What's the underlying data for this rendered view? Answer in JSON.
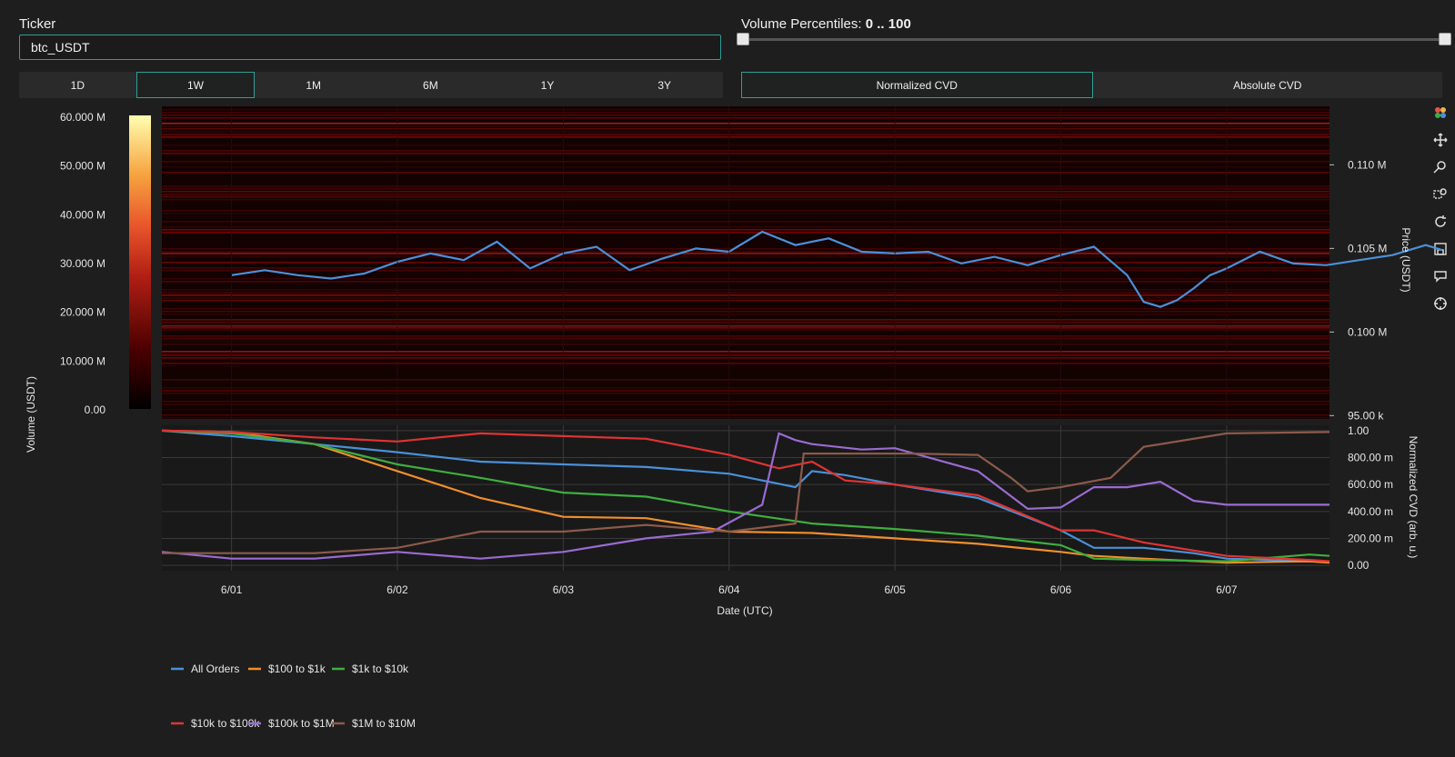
{
  "ticker": {
    "label": "Ticker",
    "value": "btc_USDT"
  },
  "volume_percentiles": {
    "label": "Volume Percentiles:",
    "value": "0 .. 100",
    "min": 0,
    "max": 100
  },
  "timeframes": [
    {
      "label": "1D",
      "active": false
    },
    {
      "label": "1W",
      "active": true
    },
    {
      "label": "1M",
      "active": false
    },
    {
      "label": "6M",
      "active": false
    },
    {
      "label": "1Y",
      "active": false
    },
    {
      "label": "3Y",
      "active": false
    }
  ],
  "cvd_modes": [
    {
      "label": "Normalized CVD",
      "active": true
    },
    {
      "label": "Absolute CVD",
      "active": false
    }
  ],
  "toolbar": [
    {
      "icon": "plotly-logo-icon"
    },
    {
      "icon": "pan-icon"
    },
    {
      "icon": "zoom-icon"
    },
    {
      "icon": "box-select-icon"
    },
    {
      "icon": "reset-icon"
    },
    {
      "icon": "save-icon"
    },
    {
      "icon": "hover-icon"
    },
    {
      "icon": "crosshair-icon"
    }
  ],
  "colors": {
    "accent": "#2f9e95",
    "price": "#4a90d9"
  },
  "chart_data": [
    {
      "type": "heatmap",
      "colorbar": {
        "title": "Volume (USDT)",
        "ticks": [
          "60.000 M",
          "50.000 M",
          "40.000 M",
          "30.000 M",
          "20.000 M",
          "10.000 M",
          "0.00"
        ],
        "range": [
          0,
          60
        ]
      },
      "y2label": "Price (USDT)",
      "y2ticks": [
        {
          "label": "0.110 M",
          "value": 110000
        },
        {
          "label": "0.105 M",
          "value": 105000
        },
        {
          "label": "0.100 M",
          "value": 100000
        },
        {
          "label": "95.00 k",
          "value": 95000
        }
      ],
      "ylim": [
        94800,
        113500
      ],
      "price_series": {
        "name": "price",
        "x": [
          0.0,
          0.2,
          0.4,
          0.6,
          0.8,
          1.0,
          1.2,
          1.4,
          1.6,
          1.8,
          2.0,
          2.2,
          2.4,
          2.6,
          2.8,
          3.0,
          3.2,
          3.4,
          3.6,
          3.8,
          4.0,
          4.2,
          4.4,
          4.6,
          4.8,
          5.0,
          5.2,
          5.4,
          5.5,
          5.6,
          5.7,
          5.8,
          5.9,
          6.0,
          6.2,
          6.4,
          6.6,
          6.8,
          7.0,
          7.2,
          7.3
        ],
        "y": [
          103400,
          103700,
          103400,
          103200,
          103500,
          104200,
          104700,
          104300,
          105400,
          103800,
          104700,
          105100,
          103700,
          104400,
          105000,
          104800,
          106000,
          105200,
          105600,
          104800,
          104700,
          104800,
          104100,
          104500,
          104000,
          104600,
          105100,
          103400,
          101800,
          101500,
          101900,
          102600,
          103400,
          103800,
          104800,
          104100,
          104000,
          104300,
          104600,
          105200,
          104900
        ]
      }
    },
    {
      "type": "line",
      "xlabel": "Date (UTC)",
      "ylabel": "Normalized CVD (arb. u.)",
      "categories": [
        "6/01",
        "6/02",
        "6/03",
        "6/04",
        "6/05",
        "6/06",
        "6/07"
      ],
      "yticks": [
        "1.00",
        "800.00 m",
        "600.00 m",
        "400.00 m",
        "200.00 m",
        "0.00"
      ],
      "xlim": [
        -0.42,
        6.62
      ],
      "ylim": [
        -0.04,
        1.04
      ],
      "series": [
        {
          "name": "All Orders",
          "color": "#4a90d9",
          "x": [
            -0.42,
            0.0,
            0.5,
            1.0,
            1.5,
            2.0,
            2.5,
            3.0,
            3.4,
            3.5,
            3.7,
            4.0,
            4.5,
            5.0,
            5.2,
            5.5,
            5.8,
            6.0,
            6.5,
            6.62
          ],
          "y": [
            1.0,
            0.96,
            0.9,
            0.84,
            0.77,
            0.75,
            0.73,
            0.68,
            0.58,
            0.7,
            0.67,
            0.6,
            0.5,
            0.26,
            0.13,
            0.13,
            0.09,
            0.05,
            0.03,
            0.03
          ]
        },
        {
          "name": "$100 to $1k",
          "color": "#f08f2a",
          "x": [
            -0.42,
            0.0,
            0.5,
            1.0,
            1.5,
            2.0,
            2.5,
            3.0,
            3.5,
            4.0,
            4.5,
            5.0,
            5.2,
            5.5,
            6.0,
            6.5,
            6.62
          ],
          "y": [
            1.0,
            0.99,
            0.9,
            0.7,
            0.5,
            0.36,
            0.35,
            0.25,
            0.24,
            0.2,
            0.16,
            0.1,
            0.07,
            0.05,
            0.02,
            0.03,
            0.02
          ]
        },
        {
          "name": "$1k to $10k",
          "color": "#3fae3f",
          "x": [
            -0.42,
            0.0,
            0.5,
            1.0,
            1.5,
            2.0,
            2.5,
            3.0,
            3.5,
            4.0,
            4.5,
            5.0,
            5.2,
            5.5,
            6.0,
            6.5,
            6.62
          ],
          "y": [
            1.0,
            0.98,
            0.9,
            0.75,
            0.65,
            0.54,
            0.51,
            0.4,
            0.31,
            0.27,
            0.22,
            0.15,
            0.05,
            0.04,
            0.03,
            0.08,
            0.07
          ]
        },
        {
          "name": "$10k to $100k",
          "color": "#e03333",
          "x": [
            -0.42,
            0.0,
            0.5,
            1.0,
            1.5,
            2.0,
            2.5,
            3.0,
            3.3,
            3.5,
            3.7,
            4.0,
            4.5,
            5.0,
            5.2,
            5.5,
            6.0,
            6.5,
            6.62
          ],
          "y": [
            1.0,
            0.99,
            0.95,
            0.92,
            0.98,
            0.96,
            0.94,
            0.82,
            0.72,
            0.77,
            0.63,
            0.6,
            0.52,
            0.26,
            0.26,
            0.17,
            0.07,
            0.04,
            0.03
          ]
        },
        {
          "name": "$100k to $1M",
          "color": "#9a6bd1",
          "x": [
            -0.42,
            0.0,
            0.5,
            1.0,
            1.5,
            2.0,
            2.5,
            2.9,
            3.2,
            3.3,
            3.4,
            3.5,
            3.8,
            4.0,
            4.5,
            4.8,
            5.0,
            5.2,
            5.4,
            5.6,
            5.8,
            6.0,
            6.5,
            6.62
          ],
          "y": [
            0.1,
            0.05,
            0.05,
            0.1,
            0.05,
            0.1,
            0.2,
            0.25,
            0.45,
            0.98,
            0.93,
            0.9,
            0.86,
            0.87,
            0.7,
            0.42,
            0.43,
            0.58,
            0.58,
            0.62,
            0.48,
            0.45,
            0.45,
            0.45
          ]
        },
        {
          "name": "$1M to $10M",
          "color": "#8c5a4a",
          "x": [
            -0.42,
            0.0,
            0.5,
            1.0,
            1.5,
            2.0,
            2.5,
            3.0,
            3.4,
            3.45,
            4.0,
            4.1,
            4.5,
            4.7,
            4.8,
            5.0,
            5.3,
            5.5,
            6.0,
            6.62
          ],
          "y": [
            0.09,
            0.09,
            0.09,
            0.13,
            0.25,
            0.25,
            0.3,
            0.25,
            0.31,
            0.83,
            0.83,
            0.83,
            0.82,
            0.65,
            0.55,
            0.58,
            0.65,
            0.88,
            0.98,
            0.99
          ]
        }
      ]
    }
  ]
}
